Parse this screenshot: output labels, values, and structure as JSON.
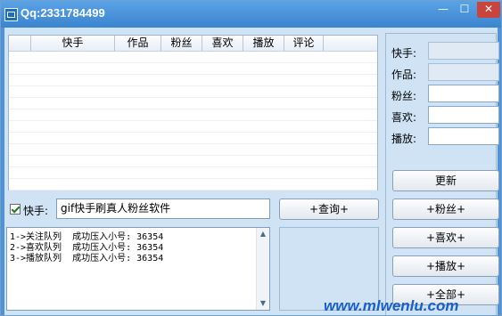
{
  "window": {
    "title": "Qq:2331784499",
    "min": "—",
    "max": "☐",
    "close": "✕"
  },
  "table": {
    "columns": [
      "快手",
      "作品",
      "粉丝",
      "喜欢",
      "播放",
      "评论"
    ]
  },
  "fields": [
    {
      "label": "快手:",
      "value": "",
      "disabled": true
    },
    {
      "label": "作品:",
      "value": "",
      "disabled": true
    },
    {
      "label": "粉丝:",
      "value": "",
      "disabled": false
    },
    {
      "label": "喜欢:",
      "value": "",
      "disabled": false
    },
    {
      "label": "播放:",
      "value": "",
      "disabled": false
    }
  ],
  "buttons": {
    "update": "更新",
    "fans": "+粉丝+",
    "likes": "+喜欢+",
    "plays": "+播放+",
    "all": "+全部+",
    "query": "+查询+"
  },
  "kuaishou": {
    "checked": true,
    "label": "快手:",
    "input": "gif快手刷真人粉丝软件"
  },
  "log": [
    "1->关注队列  成功压入小号: 36354",
    "2->喜欢队列  成功压入小号: 36354",
    "3->播放队列  成功压入小号: 36354"
  ],
  "watermark": "www.mlwenlu.com"
}
